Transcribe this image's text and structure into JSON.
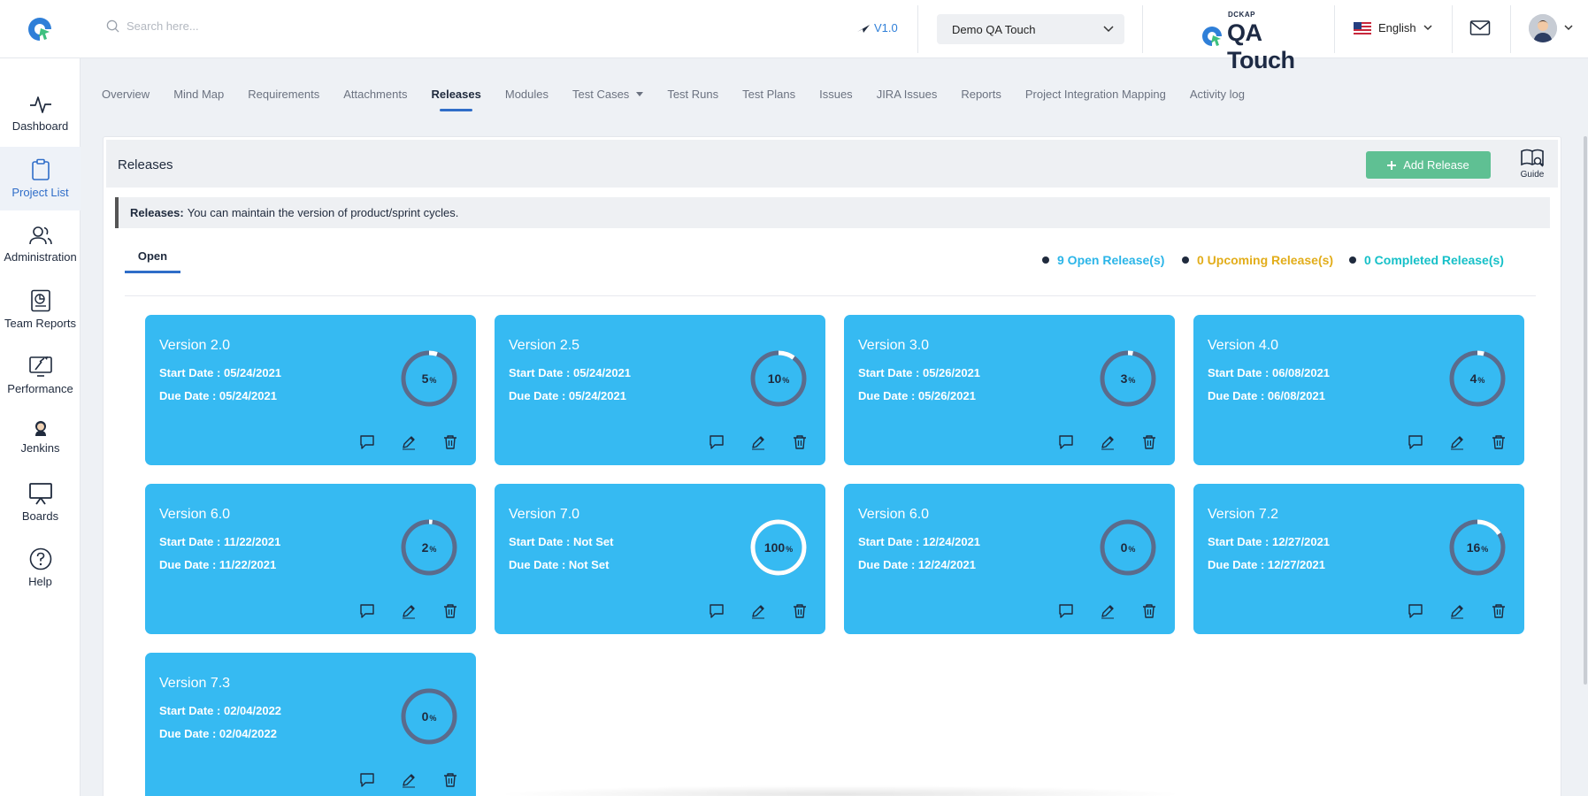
{
  "header": {
    "search_placeholder": "Search here...",
    "version": "V1.0",
    "project_selected": "Demo QA Touch",
    "brand_small": "DCKAP",
    "brand_name": "QA Touch",
    "language": "English"
  },
  "sidebar": {
    "items": [
      {
        "label": "Dashboard",
        "icon": "activity-icon"
      },
      {
        "label": "Project List",
        "icon": "clipboard-icon",
        "active": true
      },
      {
        "label": "Administration",
        "icon": "users-icon"
      },
      {
        "label": "Team Reports",
        "icon": "report-icon"
      },
      {
        "label": "Performance",
        "icon": "performance-icon"
      },
      {
        "label": "Jenkins",
        "icon": "jenkins-icon"
      },
      {
        "label": "Boards",
        "icon": "board-icon"
      },
      {
        "label": "Help",
        "icon": "help-icon"
      }
    ]
  },
  "nav": {
    "tabs": [
      {
        "label": "Overview"
      },
      {
        "label": "Mind Map"
      },
      {
        "label": "Requirements"
      },
      {
        "label": "Attachments"
      },
      {
        "label": "Releases",
        "active": true
      },
      {
        "label": "Modules"
      },
      {
        "label": "Test Cases",
        "dropdown": true
      },
      {
        "label": "Test Runs"
      },
      {
        "label": "Test Plans"
      },
      {
        "label": "Issues"
      },
      {
        "label": "JIRA Issues"
      },
      {
        "label": "Reports"
      },
      {
        "label": "Project Integration Mapping"
      },
      {
        "label": "Activity log"
      }
    ]
  },
  "releases": {
    "title": "Releases",
    "add_button": "Add Release",
    "guide_label": "Guide",
    "info_bold": "Releases:",
    "info_text": "You can maintain the version of product/sprint cycles.",
    "open_tab": "Open",
    "counts": [
      {
        "label": "9 Open Release(s)",
        "color": "#2bb5e8"
      },
      {
        "label": "0 Upcoming Release(s)",
        "color": "#e2ad1a"
      },
      {
        "label": "0 Completed Release(s)",
        "color": "#16c0c8"
      }
    ],
    "cards": [
      {
        "title": "Version 2.0",
        "start": "Start Date : 05/24/2021",
        "due": "Due Date : 05/24/2021",
        "progress": 5,
        "progress_label": "5"
      },
      {
        "title": "Version 2.5",
        "start": "Start Date : 05/24/2021",
        "due": "Due Date : 05/24/2021",
        "progress": 10,
        "progress_label": "10"
      },
      {
        "title": "Version 3.0",
        "start": "Start Date : 05/26/2021",
        "due": "Due Date : 05/26/2021",
        "progress": 3,
        "progress_label": "3"
      },
      {
        "title": "Version 4.0",
        "start": "Start Date : 06/08/2021",
        "due": "Due Date : 06/08/2021",
        "progress": 4,
        "progress_label": "4"
      },
      {
        "title": "Version 6.0",
        "start": "Start Date : 11/22/2021",
        "due": "Due Date : 11/22/2021",
        "progress": 2,
        "progress_label": "2"
      },
      {
        "title": "Version 7.0",
        "start": "Start Date : Not Set",
        "due": "Due Date : Not Set",
        "progress": 100,
        "progress_label": "100"
      },
      {
        "title": "Version 6.0",
        "start": "Start Date : 12/24/2021",
        "due": "Due Date : 12/24/2021",
        "progress": 0,
        "progress_label": "0"
      },
      {
        "title": "Version 7.2",
        "start": "Start Date : 12/27/2021",
        "due": "Due Date : 12/27/2021",
        "progress": 16,
        "progress_label": "16"
      },
      {
        "title": "Version 7.3",
        "start": "Start Date : 02/04/2022",
        "due": "Due Date : 02/04/2022",
        "progress": 0,
        "progress_label": "0"
      }
    ],
    "percent_symbol": "%"
  },
  "colors": {
    "card": "#36baf2",
    "ring_track": "#5b6b8c",
    "ring_fill": "#ffffff",
    "accent": "#2f6dc8",
    "add_button": "#5fc093"
  }
}
